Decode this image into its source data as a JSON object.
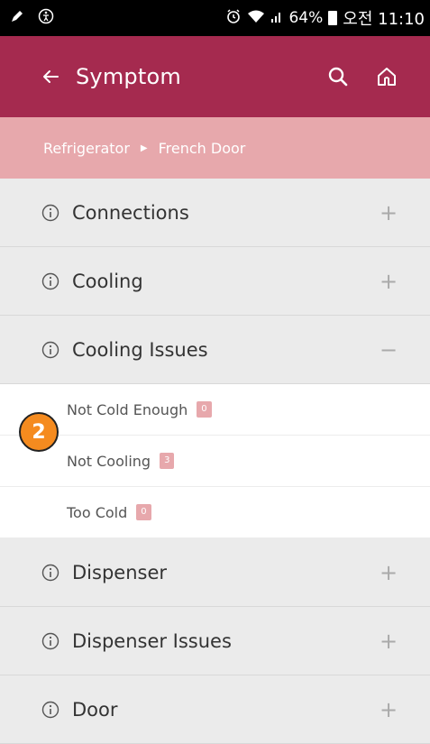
{
  "status_bar": {
    "battery": "64%",
    "time": "오전 11:10"
  },
  "app_bar": {
    "title": "Symptom"
  },
  "breadcrumb": [
    "Refrigerator",
    "French Door"
  ],
  "categories": [
    {
      "label": "Connections",
      "toggle": "+"
    },
    {
      "label": "Cooling",
      "toggle": "+"
    },
    {
      "label": "Cooling Issues",
      "toggle": "−"
    },
    {
      "label": "Dispenser",
      "toggle": "+"
    },
    {
      "label": "Dispenser Issues",
      "toggle": "+"
    },
    {
      "label": "Door",
      "toggle": "+"
    }
  ],
  "sub_items": [
    {
      "label": "Not Cold Enough",
      "count": "0"
    },
    {
      "label": "Not Cooling",
      "count": "3"
    },
    {
      "label": "Too Cold",
      "count": "0"
    }
  ],
  "step_marker": "2",
  "colors": {
    "app_bar": "#a52a4f",
    "breadcrumb": "#e7a8ac",
    "marker": "#f58b1f"
  }
}
